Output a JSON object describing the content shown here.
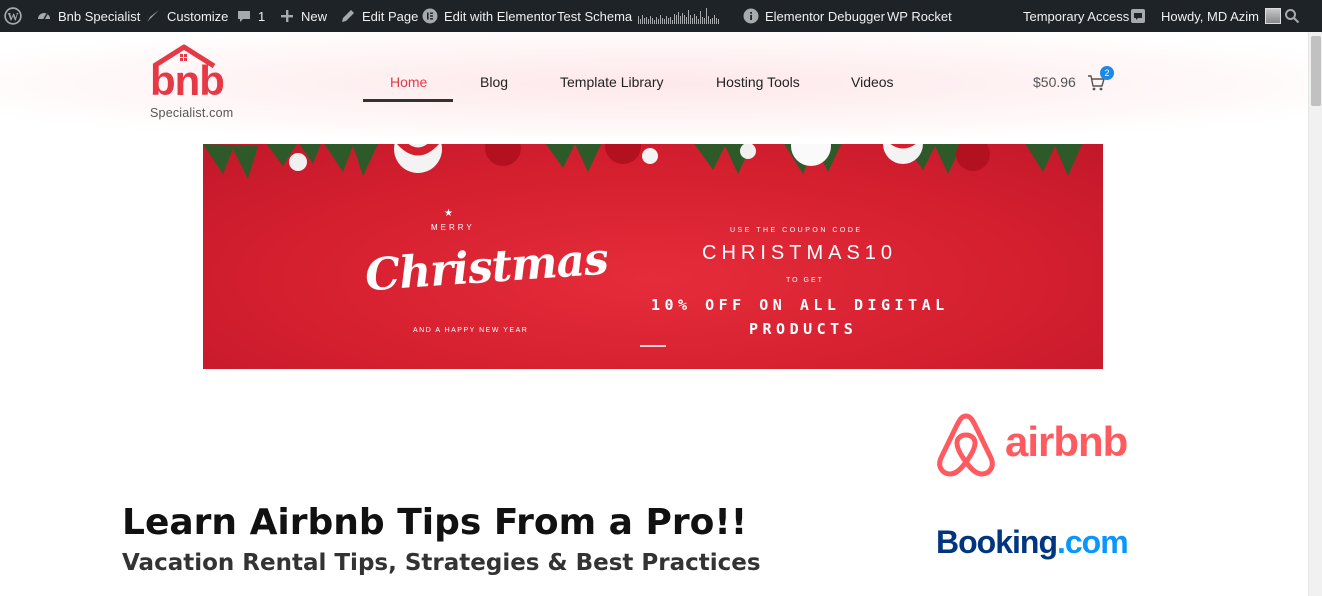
{
  "admin_bar": {
    "site_name": "Bnb Specialist",
    "customize": "Customize",
    "comments_count": "1",
    "new_label": "New",
    "edit_page": "Edit Page",
    "edit_elementor": "Edit with Elementor",
    "test_schema": "Test Schema",
    "elementor_debugger": "Elementor Debugger",
    "wp_rocket": "WP Rocket",
    "temporary_access": "Temporary Access",
    "howdy": "Howdy, MD Azim"
  },
  "header": {
    "logo_word": "bnb",
    "logo_sub": "Specialist.com",
    "nav": [
      {
        "label": "Home",
        "active": true
      },
      {
        "label": "Blog"
      },
      {
        "label": "Template Library"
      },
      {
        "label": "Hosting Tools"
      },
      {
        "label": "Videos"
      }
    ],
    "cart_total": "$50.96",
    "cart_count": "2"
  },
  "banner": {
    "merry": "MERRY",
    "script": "Christmas",
    "new_year": "AND A HAPPY NEW YEAR",
    "use_code": "USE THE COUPON CODE",
    "code": "CHRISTMAS10",
    "to_get": "TO GET",
    "offer_line1": "10% OFF ON ALL DIGITAL",
    "offer_line2": "PRODUCTS"
  },
  "hero": {
    "title": "Learn Airbnb Tips From a Pro!!",
    "subtitle": "Vacation Rental Tips, Strategies & Best Practices"
  },
  "partners": {
    "airbnb": "airbnb",
    "booking_main": "Booking",
    "booking_tld": ".com"
  },
  "colors": {
    "admin_bg": "#1d2327",
    "brand_red": "#e63946",
    "airbnb": "#ff5a5f",
    "booking_dark": "#003580",
    "booking_light": "#0896ff",
    "banner_red": "#d41f2f"
  }
}
